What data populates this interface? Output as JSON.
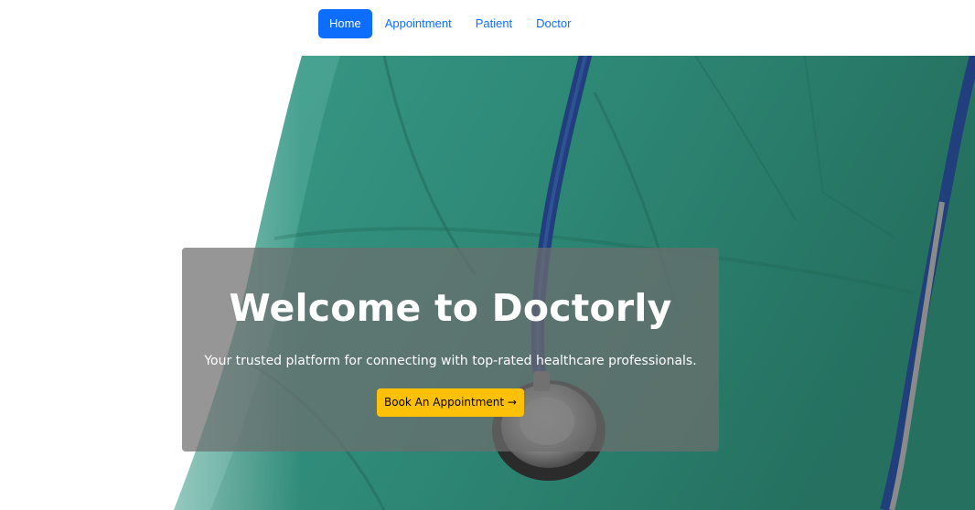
{
  "nav": {
    "items": [
      {
        "label": "Home",
        "active": true
      },
      {
        "label": "Appointment",
        "active": false
      },
      {
        "label": "Patient",
        "active": false
      },
      {
        "label": "Doctor",
        "active": false
      }
    ]
  },
  "hero": {
    "title": "Welcome to Doctorly",
    "subtitle": "Your trusted platform for connecting with top-rated healthcare professionals.",
    "cta_label": "Book An Appointment →",
    "background_icon": "doctor-stethoscope-photo"
  },
  "colors": {
    "primary": "#0d6efd",
    "cta": "#ffc107",
    "scrubs": "#2f8a78",
    "overlay": "#6e6e6e"
  }
}
